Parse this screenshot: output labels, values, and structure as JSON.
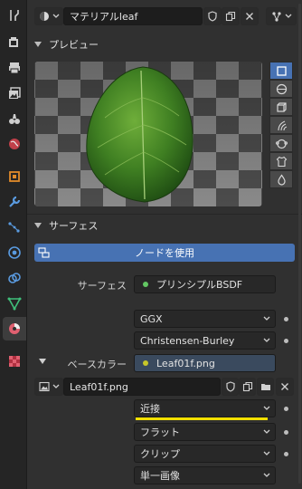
{
  "material_slot": {
    "name": "マテリアルleaf",
    "users_icon": "shield-icon",
    "copy_icon": "duplicate-icon",
    "close_icon": "close-icon"
  },
  "preview": {
    "title": "プレビュー",
    "shapes": [
      "plane",
      "sphere",
      "cube",
      "hair",
      "monkey",
      "cloth",
      "fluid"
    ]
  },
  "surface": {
    "title": "サーフェス",
    "use_nodes_label": "ノードを使用",
    "surface_label": "サーフェス",
    "surface_value": "プリンシプルBSDF",
    "distribution": "GGX",
    "subsurface_method": "Christensen-Burley",
    "base_color_label": "ベースカラー",
    "base_color_value": "Leaf01f.png",
    "image_name": "Leaf01f.png",
    "interpolation": "近接",
    "projection": "フラット",
    "extension": "クリップ",
    "source": "単一画像"
  },
  "colors": {
    "accent": "#4772b3",
    "socket_green": "#63c763",
    "socket_yellow": "#c7c729",
    "highlight": "#f2e000"
  },
  "tabs": [
    "tool",
    "render",
    "output",
    "view-layer",
    "scene",
    "world",
    "object",
    "modifiers",
    "particles",
    "physics",
    "constraints",
    "data",
    "material",
    "texture"
  ]
}
